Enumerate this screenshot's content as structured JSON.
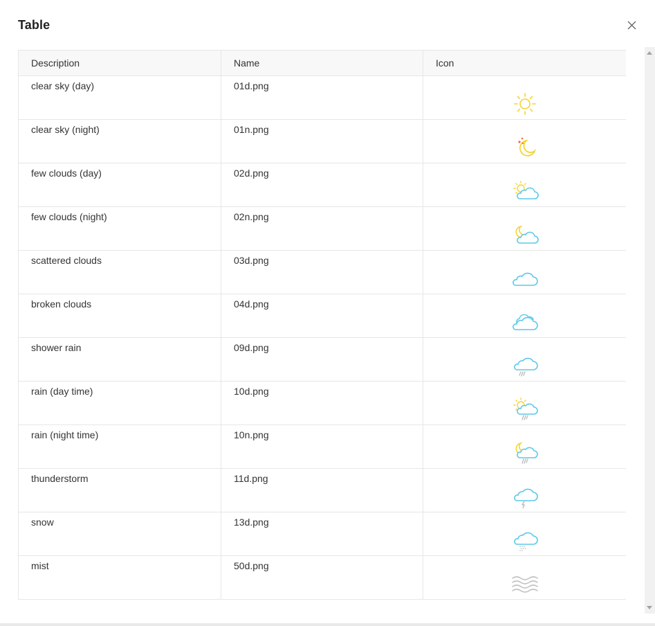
{
  "dialog": {
    "title": "Table",
    "close_icon": "close-icon"
  },
  "table": {
    "columns": [
      "Description",
      "Name",
      "Icon"
    ],
    "rows": [
      {
        "description": "clear sky (day)",
        "name": "01d.png",
        "icon": "sun-icon"
      },
      {
        "description": "clear sky (night)",
        "name": "01n.png",
        "icon": "moon-stars-icon"
      },
      {
        "description": "few clouds (day)",
        "name": "02d.png",
        "icon": "sun-cloud-icon"
      },
      {
        "description": "few clouds (night)",
        "name": "02n.png",
        "icon": "moon-cloud-icon"
      },
      {
        "description": "scattered clouds",
        "name": "03d.png",
        "icon": "cloud-icon"
      },
      {
        "description": "broken clouds",
        "name": "04d.png",
        "icon": "clouds-icon"
      },
      {
        "description": "shower rain",
        "name": "09d.png",
        "icon": "cloud-rain-icon"
      },
      {
        "description": "rain (day time)",
        "name": "10d.png",
        "icon": "sun-cloud-rain-icon"
      },
      {
        "description": "rain (night time)",
        "name": "10n.png",
        "icon": "moon-cloud-rain-icon"
      },
      {
        "description": "thunderstorm",
        "name": "11d.png",
        "icon": "cloud-lightning-icon"
      },
      {
        "description": "snow",
        "name": "13d.png",
        "icon": "cloud-snow-icon"
      },
      {
        "description": "mist",
        "name": "50d.png",
        "icon": "mist-icon"
      }
    ]
  },
  "colors": {
    "sun": "#f5d431",
    "moon": "#f5d431",
    "stars": "#ee6a4a",
    "cloud": "#5cc8ea",
    "rain": "#b9b9b9",
    "mist": "#c4c4c4",
    "border": "#e6e6e6",
    "header_bg": "#f8f8f8"
  }
}
